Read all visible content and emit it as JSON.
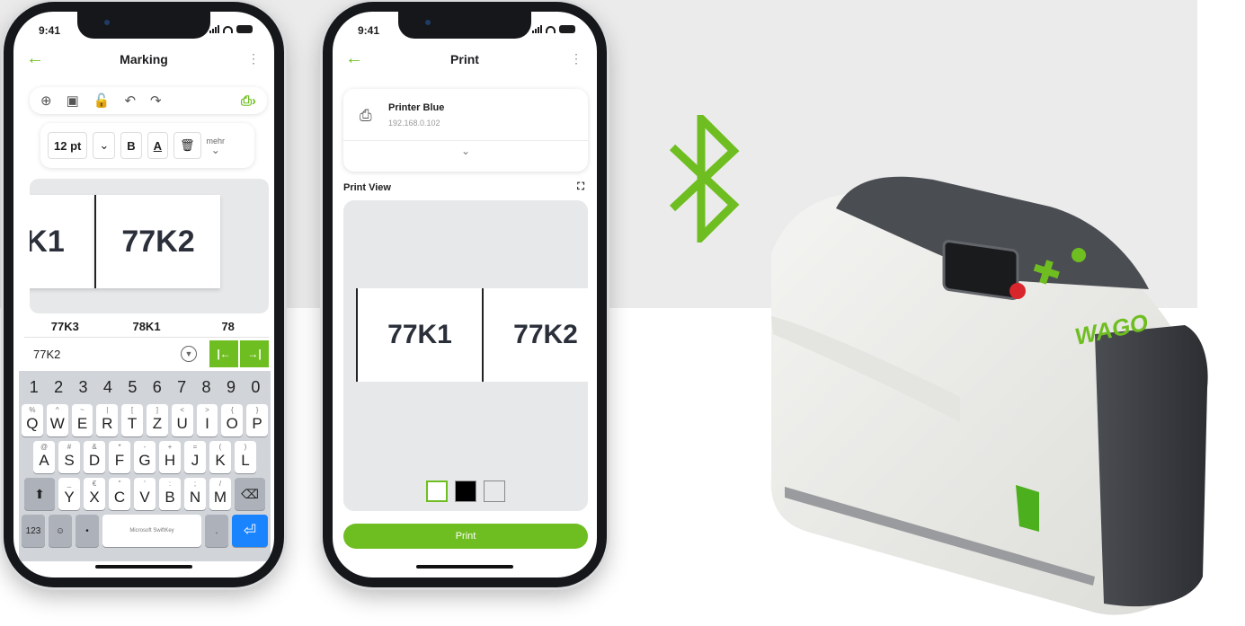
{
  "status": {
    "time": "9:41"
  },
  "marking_screen": {
    "title": "Marking",
    "back_icon": "arrow-left-icon",
    "font_size": "12 pt",
    "bold_label": "B",
    "color_label": "A",
    "more_label": "mehr",
    "labels": [
      "K1",
      "77K2"
    ],
    "suggestions": [
      "77K3",
      "78K1",
      "78"
    ],
    "input_value": "77K2",
    "number_row": [
      "1",
      "2",
      "3",
      "4",
      "5",
      "6",
      "7",
      "8",
      "9",
      "0"
    ],
    "row1": [
      {
        "k": "Q",
        "s": "%"
      },
      {
        "k": "W",
        "s": "^"
      },
      {
        "k": "E",
        "s": "~"
      },
      {
        "k": "R",
        "s": "|"
      },
      {
        "k": "T",
        "s": "["
      },
      {
        "k": "Z",
        "s": "]"
      },
      {
        "k": "U",
        "s": "<"
      },
      {
        "k": "I",
        "s": ">"
      },
      {
        "k": "O",
        "s": "{"
      },
      {
        "k": "P",
        "s": "}"
      }
    ],
    "row2": [
      {
        "k": "A",
        "s": "@"
      },
      {
        "k": "S",
        "s": "#"
      },
      {
        "k": "D",
        "s": "&"
      },
      {
        "k": "F",
        "s": "*"
      },
      {
        "k": "G",
        "s": "-"
      },
      {
        "k": "H",
        "s": "+"
      },
      {
        "k": "J",
        "s": "="
      },
      {
        "k": "K",
        "s": "("
      },
      {
        "k": "L",
        "s": ")"
      }
    ],
    "row3": [
      {
        "k": "Y",
        "s": "_"
      },
      {
        "k": "X",
        "s": "€"
      },
      {
        "k": "C",
        "s": "\""
      },
      {
        "k": "V",
        "s": "'"
      },
      {
        "k": "B",
        "s": ":"
      },
      {
        "k": "N",
        "s": ";"
      },
      {
        "k": "M",
        "s": "/"
      }
    ],
    "key_123": "123",
    "space_label": "Microsoft SwiftKey"
  },
  "print_screen": {
    "title": "Print",
    "printer_name": "Printer Blue",
    "printer_ip": "192.168.0.102",
    "print_view_label": "Print View",
    "labels": [
      "77K1",
      "77K2"
    ],
    "print_button": "Print"
  },
  "colors": {
    "accent": "#6fbe21",
    "keyboard_bg": "#d1d4d9",
    "enter_key": "#1a84ff"
  },
  "printer_device": {
    "brand": "WAGO"
  }
}
